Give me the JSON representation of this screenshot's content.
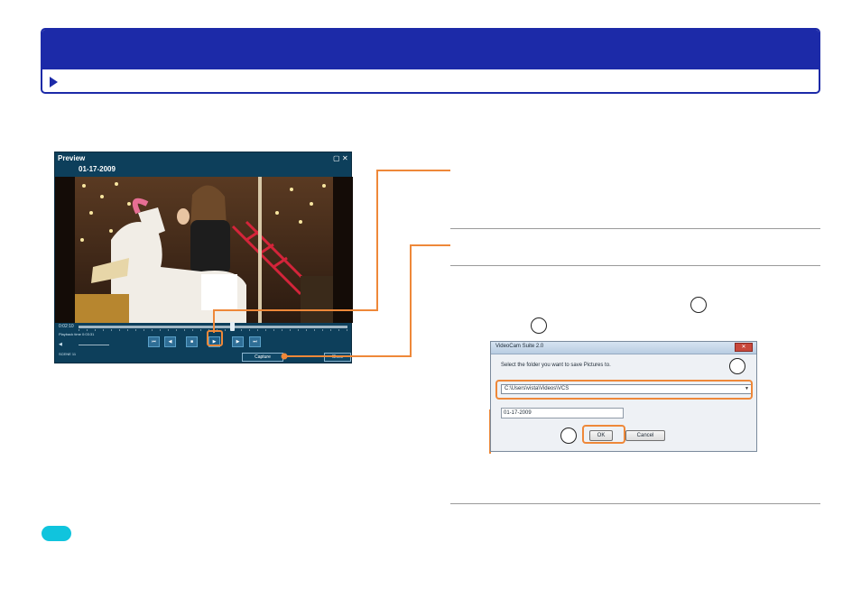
{
  "header": {
    "title": "",
    "subtitle": ""
  },
  "preview": {
    "title": "Preview",
    "date": "01-17-2009",
    "controls_restore": "▢",
    "controls_close": "✕",
    "elapsed": "0:02:10",
    "playback_label": "Playback time  0:03:31",
    "volume_label": "◀",
    "scene_label": "SCENE  11",
    "capture_label": "Capture",
    "second_button_label": "Close"
  },
  "dialog": {
    "title": "VideoCam Suite 2.0",
    "close": "✕",
    "message": "Select the folder you want to save Pictures to.",
    "folder": "C:\\Users\\vista\\Videos\\VCS",
    "folder_arrow": "▼",
    "name": "01-17-2009",
    "ok_label": "OK",
    "cancel_label": "Cancel"
  },
  "colors": {
    "header_blue": "#1c2aa8",
    "callout_orange": "#ee8839",
    "tip_cyan": "#10c4dd"
  }
}
